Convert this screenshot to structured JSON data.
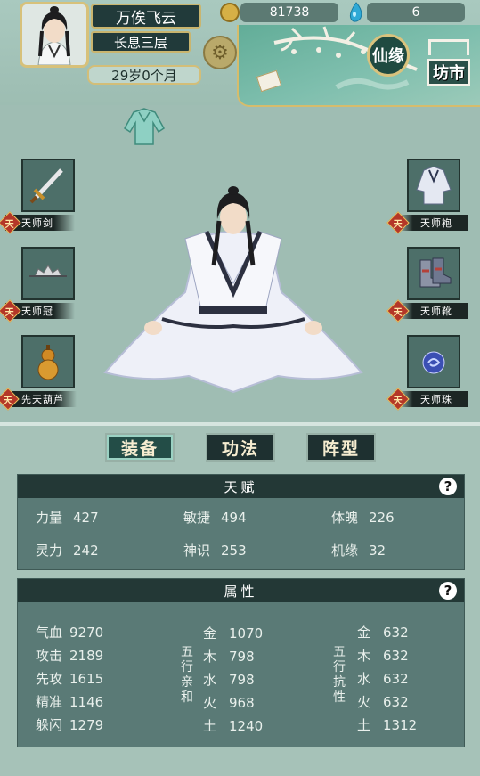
{
  "header": {
    "name": "万俟飞云",
    "realm": "长息三层",
    "age": "29岁0个月",
    "coins": "81738",
    "gems": "6",
    "xianyuan_label": "仙缘",
    "fangshi_label": "坊市"
  },
  "equipment": {
    "left": [
      {
        "label": "天师剑",
        "icon": "sword-icon"
      },
      {
        "label": "天师冠",
        "icon": "crown-icon"
      },
      {
        "label": "先天葫芦",
        "icon": "gourd-icon"
      }
    ],
    "right": [
      {
        "label": "天师袍",
        "icon": "robe-icon"
      },
      {
        "label": "天师靴",
        "icon": "boots-icon"
      },
      {
        "label": "天师珠",
        "icon": "orb-icon"
      }
    ],
    "badge": "天"
  },
  "tabs": [
    {
      "label": "装备",
      "active": true
    },
    {
      "label": "功法",
      "active": false
    },
    {
      "label": "阵型",
      "active": false
    }
  ],
  "talent": {
    "title": "天赋",
    "help": "?",
    "stats": [
      {
        "name": "力量",
        "value": "427"
      },
      {
        "name": "敏捷",
        "value": "494"
      },
      {
        "name": "体魄",
        "value": "226"
      },
      {
        "name": "灵力",
        "value": "242"
      },
      {
        "name": "神识",
        "value": "253"
      },
      {
        "name": "机缘",
        "value": "32"
      }
    ]
  },
  "attributes": {
    "title": "属性",
    "help": "?",
    "basic": [
      {
        "name": "气血",
        "value": "9270"
      },
      {
        "name": "攻击",
        "value": "2189"
      },
      {
        "name": "先攻",
        "value": "1615"
      },
      {
        "name": "精准",
        "value": "1146"
      },
      {
        "name": "躲闪",
        "value": "1279"
      }
    ],
    "affinity_label": "五行亲和",
    "affinity": [
      {
        "name": "金",
        "value": "1070"
      },
      {
        "name": "木",
        "value": "798"
      },
      {
        "name": "水",
        "value": "798"
      },
      {
        "name": "火",
        "value": "968"
      },
      {
        "name": "土",
        "value": "1240"
      }
    ],
    "resist_label": "五行抗性",
    "resist": [
      {
        "name": "金",
        "value": "632"
      },
      {
        "name": "木",
        "value": "632"
      },
      {
        "name": "水",
        "value": "632"
      },
      {
        "name": "火",
        "value": "632"
      },
      {
        "name": "土",
        "value": "1312"
      }
    ]
  },
  "colors": {
    "panel": "#5a7a76",
    "header_dark": "#233836",
    "gold": "#d6bc6c"
  }
}
